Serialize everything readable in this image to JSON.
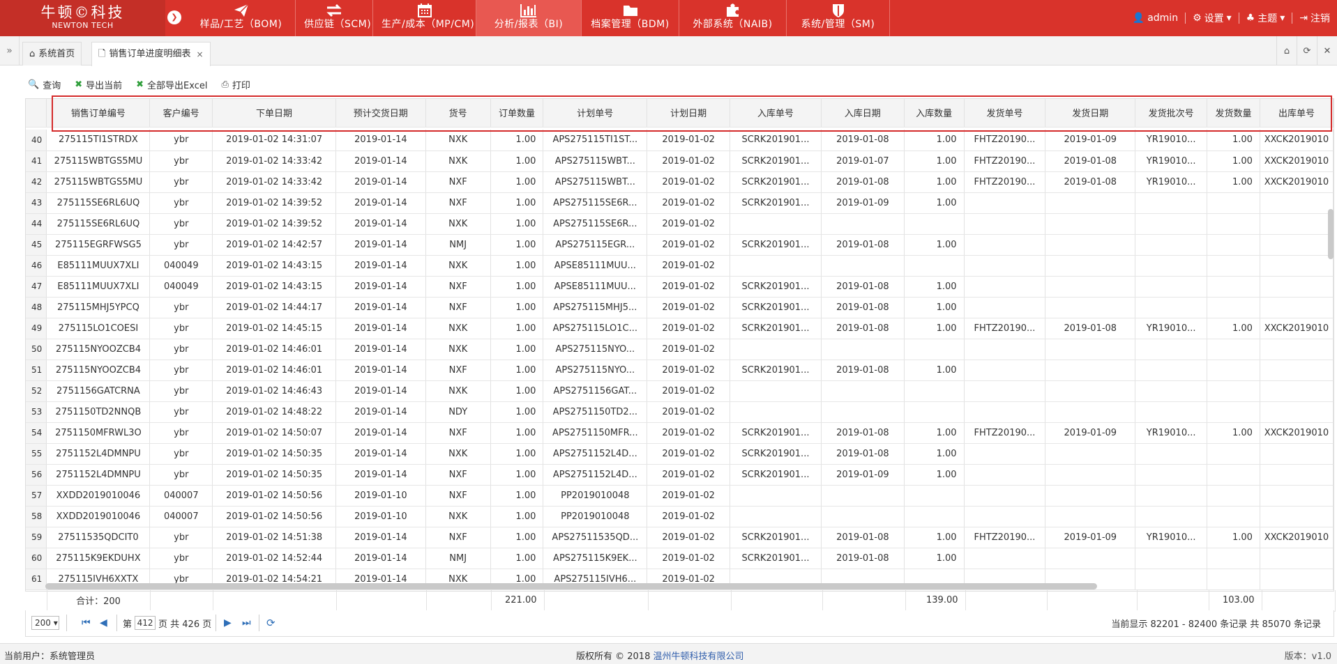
{
  "app": {
    "logo_cn": "牛顿©科技",
    "logo_en": "NEWTON TECH",
    "modules": [
      {
        "label": "样品/工艺（BOM)",
        "icon": "paper-plane-icon"
      },
      {
        "label": "供应链（SCM)",
        "icon": "exchange-icon"
      },
      {
        "label": "生产/成本（MP/CM)",
        "icon": "calendar-icon"
      },
      {
        "label": "分析/报表（BI)",
        "icon": "bar-chart-icon"
      },
      {
        "label": "档案管理（BDM)",
        "icon": "folder-icon"
      },
      {
        "label": "外部系统（NAIB)",
        "icon": "puzzle-icon"
      },
      {
        "label": "系统/管理（SM)",
        "icon": "shield-icon"
      }
    ],
    "active_module": 3,
    "user": "admin",
    "settings": "设置",
    "theme": "主题",
    "logout": "注销",
    "accent": "#d9332b"
  },
  "tabs": {
    "home": "系统首页",
    "current": "销售订单进度明细表",
    "close": "×"
  },
  "toolbar": {
    "query": "查询",
    "export_current": "导出当前",
    "export_all": "全部导出Excel",
    "print": "打印"
  },
  "table": {
    "columns": [
      "销售订单编号",
      "客户编号",
      "下单日期",
      "预计交货日期",
      "货号",
      "订单数量",
      "计划单号",
      "计划日期",
      "入库单号",
      "入库日期",
      "入库数量",
      "发货单号",
      "发货日期",
      "发货批次号",
      "发货数量",
      "出库单号"
    ],
    "rows": [
      [
        "40",
        "275115TI1STRDX",
        "ybr",
        "2019-01-02 14:31:07",
        "2019-01-14",
        "NXK",
        "1.00",
        "APS275115TI1ST...",
        "2019-01-02",
        "SCRK201901...",
        "2019-01-08",
        "1.00",
        "FHTZ20190...",
        "2019-01-09",
        "YR19010...",
        "1.00",
        "XXCK2019010"
      ],
      [
        "41",
        "275115WBTGS5MU",
        "ybr",
        "2019-01-02 14:33:42",
        "2019-01-14",
        "NXK",
        "1.00",
        "APS275115WBT...",
        "2019-01-02",
        "SCRK201901...",
        "2019-01-07",
        "1.00",
        "FHTZ20190...",
        "2019-01-08",
        "YR19010...",
        "1.00",
        "XXCK2019010"
      ],
      [
        "42",
        "275115WBTGS5MU",
        "ybr",
        "2019-01-02 14:33:42",
        "2019-01-14",
        "NXF",
        "1.00",
        "APS275115WBT...",
        "2019-01-02",
        "SCRK201901...",
        "2019-01-08",
        "1.00",
        "FHTZ20190...",
        "2019-01-08",
        "YR19010...",
        "1.00",
        "XXCK2019010"
      ],
      [
        "43",
        "275115SE6RL6UQ",
        "ybr",
        "2019-01-02 14:39:52",
        "2019-01-14",
        "NXF",
        "1.00",
        "APS275115SE6R...",
        "2019-01-02",
        "SCRK201901...",
        "2019-01-09",
        "1.00",
        "",
        "",
        "",
        "",
        ""
      ],
      [
        "44",
        "275115SE6RL6UQ",
        "ybr",
        "2019-01-02 14:39:52",
        "2019-01-14",
        "NXK",
        "1.00",
        "APS275115SE6R...",
        "2019-01-02",
        "",
        "",
        "",
        "",
        "",
        "",
        "",
        ""
      ],
      [
        "45",
        "275115EGRFWSG5",
        "ybr",
        "2019-01-02 14:42:57",
        "2019-01-14",
        "NMJ",
        "1.00",
        "APS275115EGR...",
        "2019-01-02",
        "SCRK201901...",
        "2019-01-08",
        "1.00",
        "",
        "",
        "",
        "",
        ""
      ],
      [
        "46",
        "E85111MUUX7XLI",
        "040049",
        "2019-01-02 14:43:15",
        "2019-01-14",
        "NXK",
        "1.00",
        "APSE85111MUU...",
        "2019-01-02",
        "",
        "",
        "",
        "",
        "",
        "",
        "",
        ""
      ],
      [
        "47",
        "E85111MUUX7XLI",
        "040049",
        "2019-01-02 14:43:15",
        "2019-01-14",
        "NXF",
        "1.00",
        "APSE85111MUU...",
        "2019-01-02",
        "SCRK201901...",
        "2019-01-08",
        "1.00",
        "",
        "",
        "",
        "",
        ""
      ],
      [
        "48",
        "275115MHJ5YPCQ",
        "ybr",
        "2019-01-02 14:44:17",
        "2019-01-14",
        "NXF",
        "1.00",
        "APS275115MHJ5...",
        "2019-01-02",
        "SCRK201901...",
        "2019-01-08",
        "1.00",
        "",
        "",
        "",
        "",
        ""
      ],
      [
        "49",
        "275115LO1COESI",
        "ybr",
        "2019-01-02 14:45:15",
        "2019-01-14",
        "NXK",
        "1.00",
        "APS275115LO1C...",
        "2019-01-02",
        "SCRK201901...",
        "2019-01-08",
        "1.00",
        "FHTZ20190...",
        "2019-01-08",
        "YR19010...",
        "1.00",
        "XXCK2019010"
      ],
      [
        "50",
        "275115NYOOZCB4",
        "ybr",
        "2019-01-02 14:46:01",
        "2019-01-14",
        "NXK",
        "1.00",
        "APS275115NYO...",
        "2019-01-02",
        "",
        "",
        "",
        "",
        "",
        "",
        "",
        ""
      ],
      [
        "51",
        "275115NYOOZCB4",
        "ybr",
        "2019-01-02 14:46:01",
        "2019-01-14",
        "NXF",
        "1.00",
        "APS275115NYO...",
        "2019-01-02",
        "SCRK201901...",
        "2019-01-08",
        "1.00",
        "",
        "",
        "",
        "",
        ""
      ],
      [
        "52",
        "2751156GATCRNA",
        "ybr",
        "2019-01-02 14:46:43",
        "2019-01-14",
        "NXK",
        "1.00",
        "APS2751156GAT...",
        "2019-01-02",
        "",
        "",
        "",
        "",
        "",
        "",
        "",
        ""
      ],
      [
        "53",
        "2751150TD2NNQB",
        "ybr",
        "2019-01-02 14:48:22",
        "2019-01-14",
        "NDY",
        "1.00",
        "APS2751150TD2...",
        "2019-01-02",
        "",
        "",
        "",
        "",
        "",
        "",
        "",
        ""
      ],
      [
        "54",
        "2751150MFRWL3O",
        "ybr",
        "2019-01-02 14:50:07",
        "2019-01-14",
        "NXF",
        "1.00",
        "APS2751150MFR...",
        "2019-01-02",
        "SCRK201901...",
        "2019-01-08",
        "1.00",
        "FHTZ20190...",
        "2019-01-09",
        "YR19010...",
        "1.00",
        "XXCK2019010"
      ],
      [
        "55",
        "2751152L4DMNPU",
        "ybr",
        "2019-01-02 14:50:35",
        "2019-01-14",
        "NXK",
        "1.00",
        "APS2751152L4D...",
        "2019-01-02",
        "SCRK201901...",
        "2019-01-08",
        "1.00",
        "",
        "",
        "",
        "",
        ""
      ],
      [
        "56",
        "2751152L4DMNPU",
        "ybr",
        "2019-01-02 14:50:35",
        "2019-01-14",
        "NXF",
        "1.00",
        "APS2751152L4D...",
        "2019-01-02",
        "SCRK201901...",
        "2019-01-09",
        "1.00",
        "",
        "",
        "",
        "",
        ""
      ],
      [
        "57",
        "XXDD2019010046",
        "040007",
        "2019-01-02 14:50:56",
        "2019-01-10",
        "NXF",
        "1.00",
        "PP2019010048",
        "2019-01-02",
        "",
        "",
        "",
        "",
        "",
        "",
        "",
        ""
      ],
      [
        "58",
        "XXDD2019010046",
        "040007",
        "2019-01-02 14:50:56",
        "2019-01-10",
        "NXK",
        "1.00",
        "PP2019010048",
        "2019-01-02",
        "",
        "",
        "",
        "",
        "",
        "",
        "",
        ""
      ],
      [
        "59",
        "27511535QDCIT0",
        "ybr",
        "2019-01-02 14:51:38",
        "2019-01-14",
        "NXF",
        "1.00",
        "APS27511535QD...",
        "2019-01-02",
        "SCRK201901...",
        "2019-01-08",
        "1.00",
        "FHTZ20190...",
        "2019-01-09",
        "YR19010...",
        "1.00",
        "XXCK2019010"
      ],
      [
        "60",
        "275115K9EKDUHX",
        "ybr",
        "2019-01-02 14:52:44",
        "2019-01-14",
        "NMJ",
        "1.00",
        "APS275115K9EK...",
        "2019-01-02",
        "SCRK201901...",
        "2019-01-08",
        "1.00",
        "",
        "",
        "",
        "",
        ""
      ],
      [
        "61",
        "275115IVH6XXTX",
        "ybr",
        "2019-01-02 14:54:21",
        "2019-01-14",
        "NXK",
        "1.00",
        "APS275115IVH6...",
        "2019-01-02",
        "",
        "",
        "",
        "",
        "",
        "",
        "",
        ""
      ]
    ],
    "summary": {
      "label": "合计：200",
      "order_qty": "221.00",
      "in_qty": "139.00",
      "ship_qty": "103.00"
    }
  },
  "pager": {
    "page_size": "200",
    "page_prefix": "第",
    "page": "412",
    "page_total": "页 共 426 页",
    "info": "当前显示 82201 - 82400 条记录 共 85070 条记录"
  },
  "footer": {
    "user": "当前用户：系统管理员",
    "copyright": "版权所有 © 2018",
    "company": "温州牛顿科技有限公司",
    "version": "版本：v1.0"
  }
}
